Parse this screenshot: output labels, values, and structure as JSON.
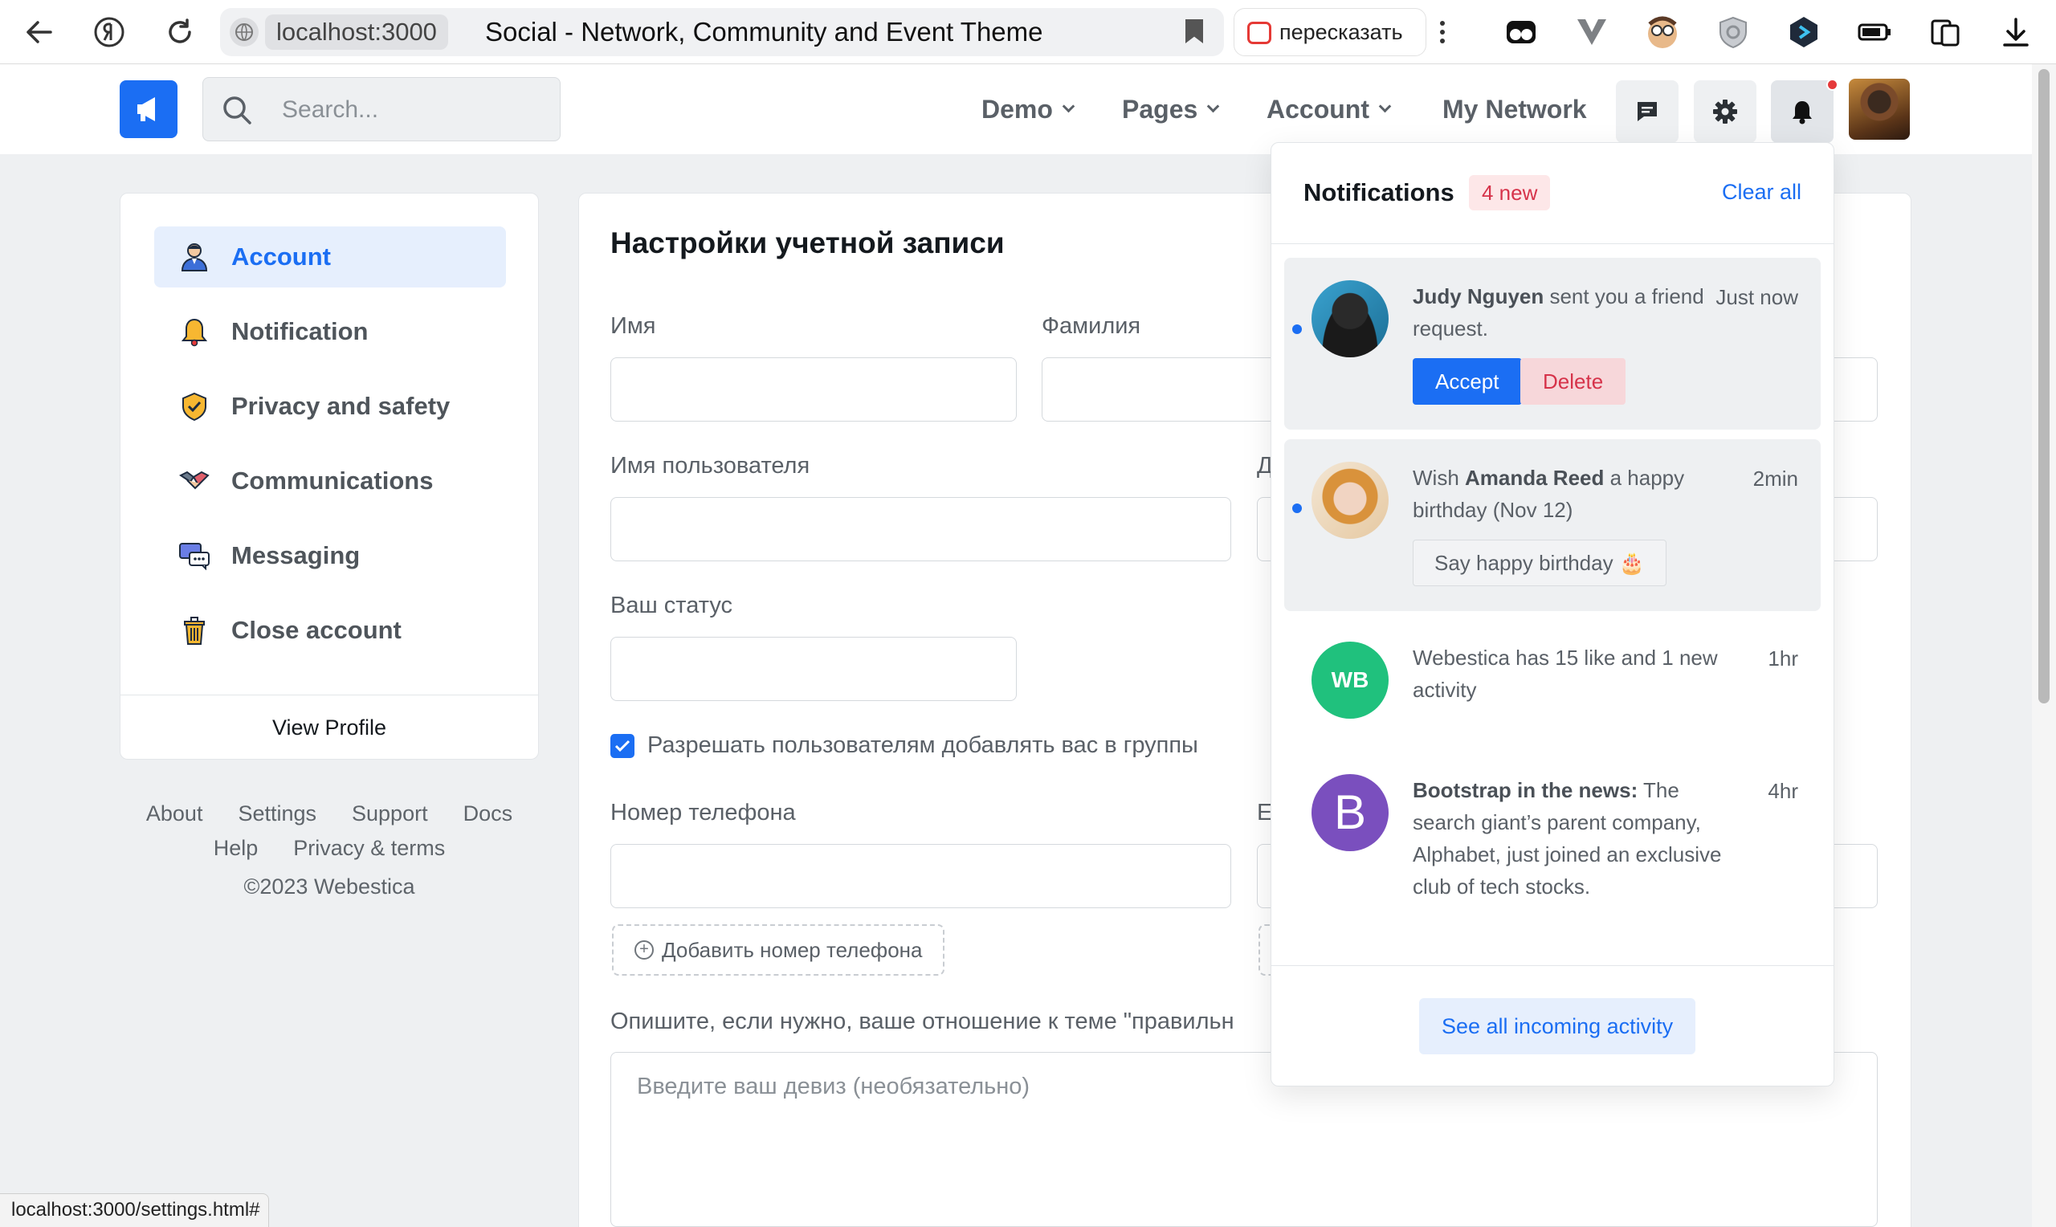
{
  "browser": {
    "host": "localhost:3000",
    "tab_title": "Social - Network, Community and Event Theme",
    "retell_label": "пересказать",
    "status_url": "localhost:3000/settings.html#"
  },
  "header": {
    "search_placeholder": "Search...",
    "nav": [
      {
        "label": "Demo",
        "dropdown": true
      },
      {
        "label": "Pages",
        "dropdown": true
      },
      {
        "label": "Account",
        "dropdown": true
      },
      {
        "label": "My Network",
        "dropdown": false
      }
    ],
    "icons": [
      "chat-icon",
      "gear-icon",
      "bell-icon"
    ]
  },
  "sidebar": {
    "items": [
      {
        "label": "Account",
        "icon": "person-icon",
        "active": true
      },
      {
        "label": "Notification",
        "icon": "bell-icon",
        "active": false
      },
      {
        "label": "Privacy and safety",
        "icon": "shield-icon",
        "active": false
      },
      {
        "label": "Communications",
        "icon": "handshake-icon",
        "active": false
      },
      {
        "label": "Messaging",
        "icon": "chat-bubbles-icon",
        "active": false
      },
      {
        "label": "Close account",
        "icon": "trash-icon",
        "active": false
      }
    ],
    "view_profile": "View Profile"
  },
  "footer": {
    "links_row1": [
      "About",
      "Settings",
      "Support",
      "Docs"
    ],
    "links_row2": [
      "Help",
      "Privacy & terms"
    ],
    "copyright": "©2023 Webestica"
  },
  "main": {
    "title": "Настройки учетной записи",
    "first_name_label": "Имя",
    "last_name_label": "Фамилия",
    "username_label": "Имя пользователя",
    "birthday_label_partial": "Д",
    "status_label": "Ваш статус",
    "allow_groups_label": "Разрешать пользователям добавлять вас в группы",
    "allow_groups_checked": true,
    "phone_label": "Номер телефона",
    "email_label_partial": "E",
    "add_phone": "Добавить номер телефона",
    "motto_label": "Опишите, если нужно, ваше отношение к теме \"правильн",
    "motto_placeholder": "Введите ваш девиз (необязательно)"
  },
  "notifications": {
    "title": "Notifications",
    "badge": "4 new",
    "clear_all": "Clear all",
    "items": [
      {
        "name": "Judy Nguyen",
        "text_after": " sent you a friend request.",
        "time": "Just now",
        "unread": true,
        "accept": "Accept",
        "delete": "Delete"
      },
      {
        "text_before": "Wish ",
        "name": "Amanda Reed",
        "text_after": " a happy birthday (Nov 12)",
        "time": "2min",
        "unread": true,
        "action": "Say happy birthday 🎂"
      },
      {
        "initials": "WB",
        "text": "Webestica has 15 like and 1 new activity",
        "time": "1hr",
        "unread": false,
        "color": "#20c17d"
      },
      {
        "initials": "B",
        "name": "Bootstrap in the news:",
        "text_after": " The search giant’s parent company, Alphabet, just joined an exclusive club of tech stocks.",
        "time": "4hr",
        "unread": false,
        "color": "#7a4fbe"
      }
    ],
    "see_all": "See all incoming activity"
  },
  "colors": {
    "primary": "#1b6ef3",
    "danger": "#d6334a",
    "page_bg": "#eef0f2"
  }
}
